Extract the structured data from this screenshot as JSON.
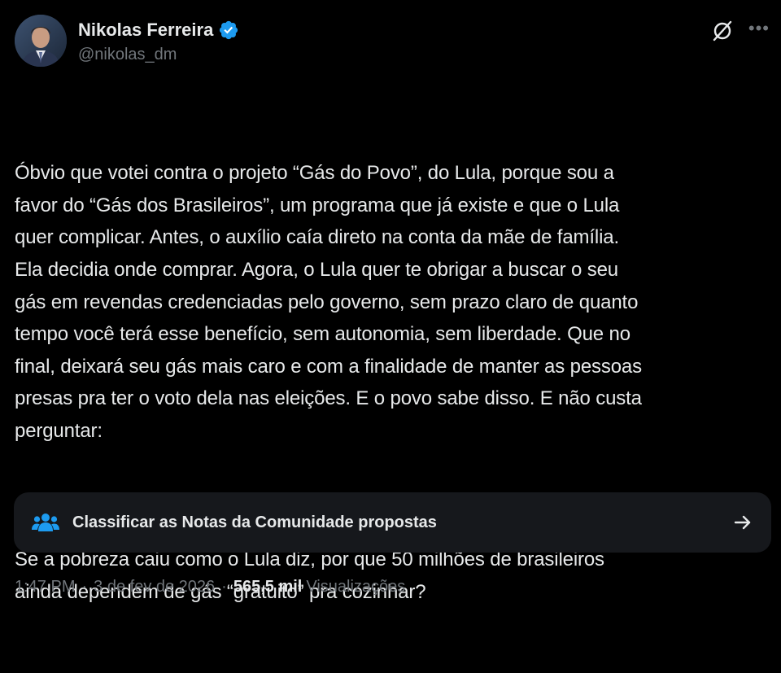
{
  "author": {
    "display_name": "Nikolas Ferreira",
    "handle": "@nikolas_dm"
  },
  "icons": {
    "verified": "verified-badge-icon",
    "grok": "grok-icon",
    "more": "more-options-icon",
    "community_notes": "community-notes-people-icon",
    "arrow": "arrow-right-icon"
  },
  "colors": {
    "background": "#000000",
    "text": "#e7e9ea",
    "muted": "#71767b",
    "verified": "#1d9bf0",
    "notes_box": "#16181c"
  },
  "tweet": {
    "paragraphs": [
      "Óbvio que votei contra o projeto “Gás do Povo”, do Lula, porque sou a\nfavor do “Gás dos Brasileiros”, um programa que já existe e que o Lula\nquer complicar. Antes, o auxílio caía direto na conta da mãe de família.\nEla decidia onde comprar. Agora, o Lula quer te obrigar a buscar o seu\ngás em revendas credenciadas pelo governo, sem prazo claro de quanto\ntempo você terá esse benefício, sem autonomia, sem liberdade. Que no\nfinal, deixará seu gás mais caro e com a finalidade de manter as pessoas\npresas pra ter o voto dela nas eleições. E o povo sabe disso. E não custa\nperguntar:",
      "Se a pobreza caiu como o Lula diz, por que 50 milhões de brasileiros\nainda dependem de gás “gratuito” pra cozinhar?"
    ]
  },
  "community_notes": {
    "label": "Classificar as Notas da Comunidade propostas"
  },
  "meta": {
    "time": "1:47 PM",
    "separator": "·",
    "date": "3 de fev de 2026",
    "views_count": "565,5 mil",
    "views_label": "Visualizações"
  }
}
